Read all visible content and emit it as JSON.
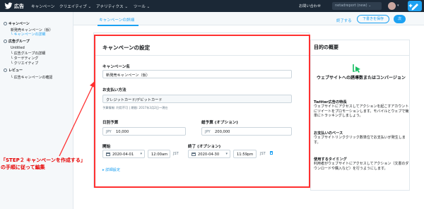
{
  "header": {
    "brand": "広告",
    "nav": [
      "キャンペーン",
      "クリエイティブ ⌄",
      "アナリティクス ⌄",
      "ツール ⌄"
    ],
    "help": "お問い合わせ",
    "account": "netadreport (new) ⌄"
  },
  "toolbar": {
    "tab_detail": "キャンペーンの詳細",
    "finish": "終了する",
    "save_draft": "下書きを保存",
    "next": "次"
  },
  "sidebar": {
    "campaign_group": "キャンペーン",
    "campaign_name": "新発売キャンペーン（仮）",
    "campaign_detail": "キャンペーンの詳細",
    "adgroup_group": "広告グループ",
    "adgroup_untitled": "Untitled",
    "adgroup_detail": "広告グループの詳細",
    "adgroup_targeting": "ターゲティング",
    "adgroup_creative": "クリエイティブ",
    "review_group": "レビュー",
    "review_confirm": "広告キャンペーンの確認"
  },
  "form": {
    "title": "キャンペーンの設定",
    "name_label": "キャンペーン名",
    "name_value": "新発売キャンペーン（仮）",
    "payment_label": "お支払い方法",
    "payment_value": "クレジットカード/デビットカード",
    "payment_note": "予算情報: 利用不可 | 期間: 2017年3月2日〜現在",
    "daily_label": "日別予算",
    "daily_currency": "JPY",
    "daily_value": "10,000",
    "total_label": "総予算 (オプション)",
    "total_currency": "JPY",
    "total_value": "200,000",
    "start_label": "開始",
    "start_date": "2020-04-01",
    "start_time": "12:00am",
    "start_tz": "JST",
    "end_label": "終了 (オプション)",
    "end_date": "2020-04-30",
    "end_time": "11:59pm",
    "end_tz": "JST",
    "advanced": "▸ 詳細設定"
  },
  "objective": {
    "title": "目的の概要",
    "name": "ウェブサイトへの誘導数またはコンバージョン",
    "feature_title": "Twitter広告の特長",
    "feature_text": "ウェブサイトにアクセスしてアクションを起こすアカウントにツイートをプロモーションします。モバイルとウェブで簡単にトラッキングしましょう。",
    "pay_title": "お支払いのベース",
    "pay_text": "ウェブサイトリンククリック数単位でお支払いが発生します。",
    "timing_title": "使用するタイミング",
    "timing_text": "利用者がウェブサイトにアクセスしてアクション（文書のダウンロードや購入など）を行うようにします。"
  },
  "annotation": {
    "line1": "「STEP２ キャンペーンを作成する」",
    "line2": "の手順に従って編集"
  },
  "colors": {
    "accent": "#1da1f2",
    "topbar": "#1b2836",
    "annotation": "#e60000",
    "objective_icon": "#17bf63"
  }
}
